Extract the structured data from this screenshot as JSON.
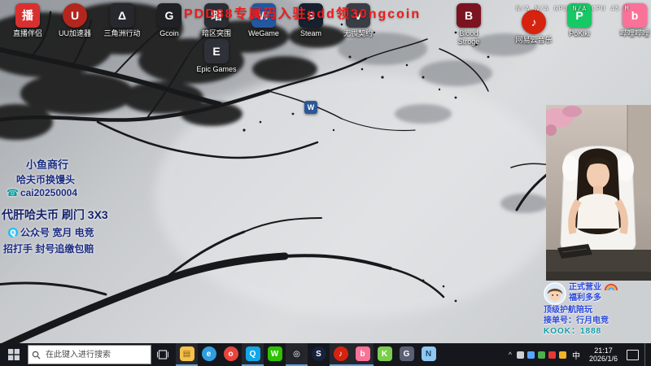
{
  "colors": {
    "announcement_red": "#f21b1b",
    "promo_navy": "#1b2c80",
    "promo_blue": "#2946d8",
    "kook_teal": "#0d9aa6",
    "taskbar_bg": "#15171d",
    "active_underline": "#5f9edb"
  },
  "announcement": {
    "text": "PDD88专属码入驻pdd领30ngcoin"
  },
  "monitor": {
    "text": "N/A  N/A  GPU N/A  CPU 45 M"
  },
  "desktop_icons": [
    {
      "label": "直播伴侣",
      "glyph": "播"
    },
    {
      "label": "UU加速器",
      "glyph": "U"
    },
    {
      "label": "三角洲行动",
      "glyph": "Δ"
    },
    {
      "label": "Gcoin",
      "glyph": "G"
    },
    {
      "label": "暗区突围",
      "glyph": "暗"
    },
    {
      "label": "WeGame",
      "glyph": "W"
    },
    {
      "label": "Steam",
      "glyph": "S"
    },
    {
      "label": "无畏契约",
      "glyph": "V"
    },
    {
      "label": "Blood Stroge",
      "glyph": "B"
    },
    {
      "label": "网易云音乐",
      "glyph": "♪"
    },
    {
      "label": "PoKiki",
      "glyph": "P"
    },
    {
      "label": "哔哩哔哩",
      "glyph": "b"
    },
    {
      "label": "Epic Games",
      "glyph": "E"
    },
    {
      "label": "",
      "glyph": "W"
    }
  ],
  "promo_left": {
    "line1": "小鱼商行",
    "line2": "哈夫币换馒头",
    "phone_icon": "☎",
    "line3": "cai20250004",
    "line4": "代肝哈夫币 刷门 3X3",
    "qq_badge": "Q",
    "line5": "公众号 宽月 电竞",
    "line6": "招打手 封号追缴包赔"
  },
  "promo_right": {
    "line1": "正式营业",
    "line2": "福利多多",
    "line3": "顶级护航陪玩",
    "line4": "接单号：行月电竞",
    "line5": "KOOK：1888"
  },
  "taskbar": {
    "search_placeholder": "在此键入进行搜索",
    "language": "中",
    "time": "21:17",
    "date": "2026/1/6",
    "apps": [
      {
        "name": "file-explorer",
        "glyph": "▤"
      },
      {
        "name": "edge",
        "glyph": "e"
      },
      {
        "name": "chrome",
        "glyph": "o"
      },
      {
        "name": "qq",
        "glyph": "Q"
      },
      {
        "name": "wechat",
        "glyph": "W"
      },
      {
        "name": "obs",
        "glyph": "◎"
      },
      {
        "name": "steam",
        "glyph": "S"
      },
      {
        "name": "netease-music",
        "glyph": "♪"
      },
      {
        "name": "bilibili",
        "glyph": "b"
      },
      {
        "name": "kook",
        "glyph": "K"
      },
      {
        "name": "game-launcher",
        "glyph": "G"
      },
      {
        "name": "notepad",
        "glyph": "N"
      }
    ]
  }
}
